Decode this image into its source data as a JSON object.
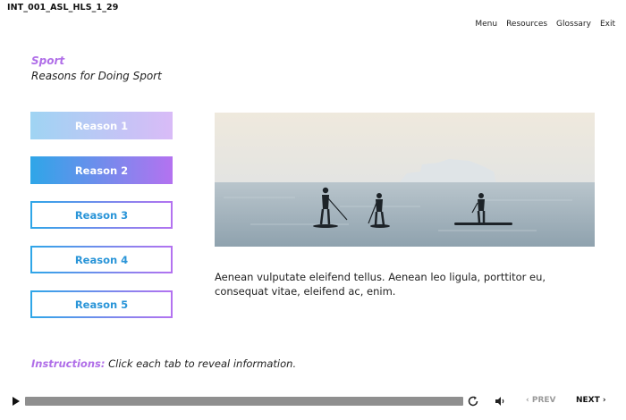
{
  "course_id": "INT_001_ASL_HLS_1_29",
  "top_nav": [
    "Menu",
    "Resources",
    "Glossary",
    "Exit"
  ],
  "section_title": "Sport",
  "page_title": "Reasons for Doing Sport",
  "tabs": [
    {
      "label": "Reason 1",
      "state": "visited"
    },
    {
      "label": "Reason 2",
      "state": "active"
    },
    {
      "label": "Reason 3",
      "state": "normal"
    },
    {
      "label": "Reason 4",
      "state": "normal"
    },
    {
      "label": "Reason 5",
      "state": "normal"
    }
  ],
  "content_text": "Aenean vulputate eleifend tellus. Aenean leo ligula, porttitor eu, consequat vitae, eleifend ac, enim.",
  "instructions": {
    "label": "Instructions:",
    "text": "Click each tab to reveal information."
  },
  "player": {
    "prev_label": "‹ PREV",
    "next_label": "NEXT ›",
    "progress": 0
  },
  "colors": {
    "accent_purple": "#b06ee8",
    "accent_blue": "#2ea6e8",
    "progress_track": "#8f8f8f"
  },
  "icons": [
    "play-icon",
    "replay-icon",
    "volume-icon"
  ]
}
